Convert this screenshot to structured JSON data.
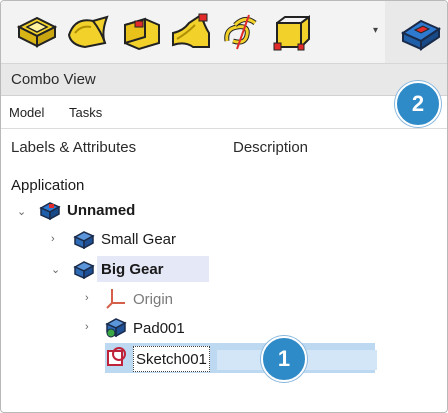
{
  "combo_view": {
    "title": "Combo View"
  },
  "tabs": [
    {
      "label": "Model"
    },
    {
      "label": "Tasks"
    }
  ],
  "columns": {
    "labels": "Labels & Attributes",
    "description": "Description"
  },
  "tree": {
    "root_label": "Application",
    "document": "Unnamed",
    "items": [
      {
        "label": "Small Gear"
      },
      {
        "label": "Big Gear"
      },
      {
        "label": "Origin"
      },
      {
        "label": "Pad001"
      },
      {
        "label": "Sketch001"
      }
    ]
  },
  "badges": {
    "first": "1",
    "second": "2"
  },
  "toolbar": {
    "icons": [
      "pad-icon",
      "revolution-icon",
      "additive-loft-icon",
      "additive-pipe-icon",
      "additive-helix-icon",
      "additive-primitive-icon",
      "create-sketch-icon"
    ]
  }
}
